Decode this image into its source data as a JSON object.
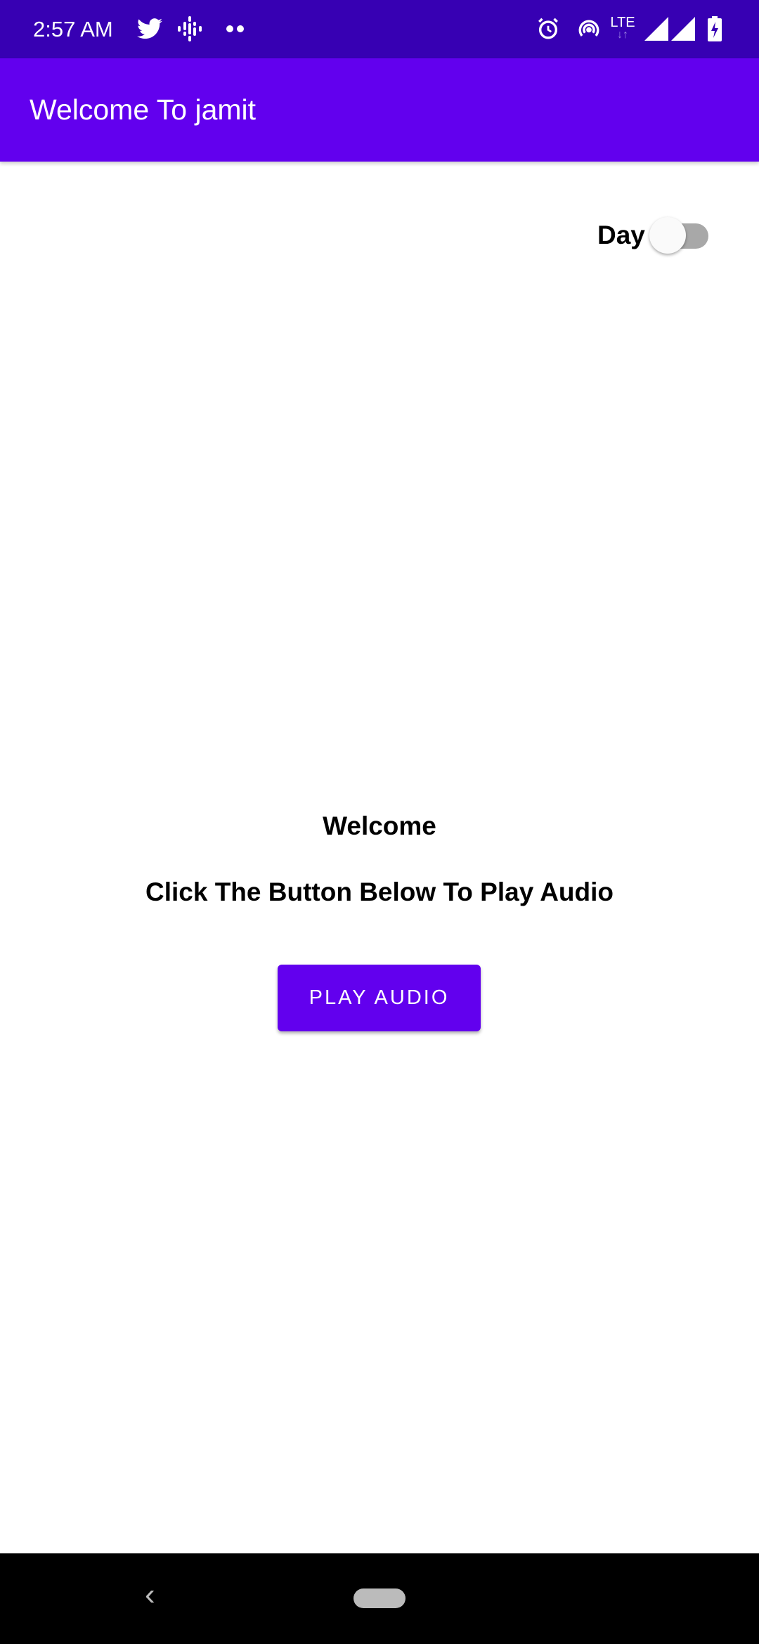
{
  "status_bar": {
    "time": "2:57 AM",
    "network": "LTE",
    "icons": [
      "twitter-icon",
      "podcast-icon",
      "more-dots-icon",
      "alarm-icon",
      "hotspot-icon",
      "lte-icon",
      "signal-icon",
      "signal-icon",
      "battery-charging-icon"
    ]
  },
  "app_bar": {
    "title": "Welcome To jamit"
  },
  "theme_toggle": {
    "label": "Day",
    "checked": false
  },
  "main": {
    "heading": "Welcome",
    "subtitle": "Click The Button Below To Play Audio",
    "play_button": "PLAY AUDIO"
  },
  "colors": {
    "primary": "#6200ee",
    "primary_dark": "#3700b3"
  }
}
